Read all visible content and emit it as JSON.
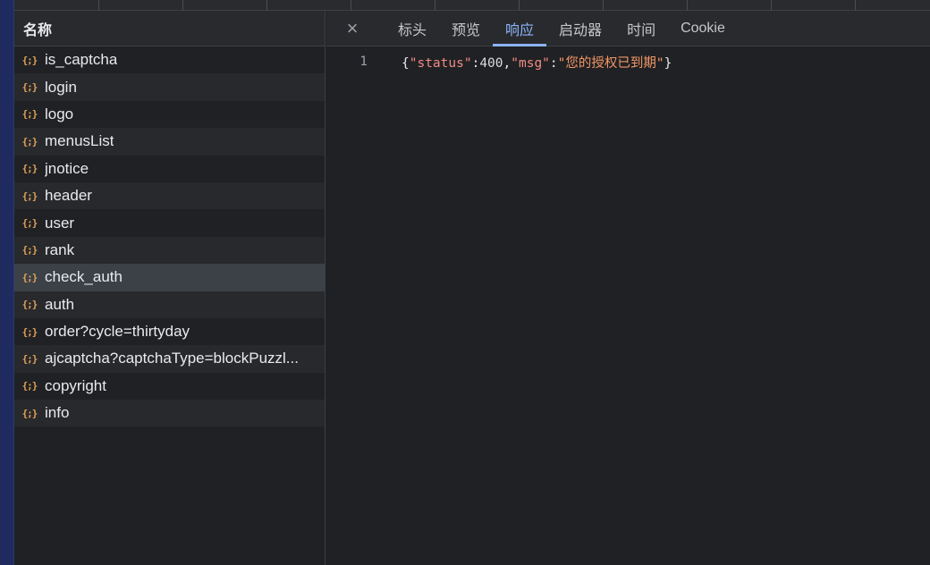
{
  "left_panel": {
    "header_label": "名称",
    "requests": [
      {
        "icon": "{;}",
        "name": "is_captcha"
      },
      {
        "icon": "{;}",
        "name": "login"
      },
      {
        "icon": "{;}",
        "name": "logo"
      },
      {
        "icon": "{;}",
        "name": "menusList"
      },
      {
        "icon": "{;}",
        "name": "jnotice"
      },
      {
        "icon": "{;}",
        "name": "header"
      },
      {
        "icon": "{;}",
        "name": "user"
      },
      {
        "icon": "{;}",
        "name": "rank"
      },
      {
        "icon": "{;}",
        "name": "check_auth"
      },
      {
        "icon": "{;}",
        "name": "auth"
      },
      {
        "icon": "{;}",
        "name": "order?cycle=thirtyday"
      },
      {
        "icon": "{;}",
        "name": "ajcaptcha?captchaType=blockPuzzl..."
      },
      {
        "icon": "{;}",
        "name": "copyright"
      },
      {
        "icon": "{;}",
        "name": "info"
      }
    ],
    "selected_index": 8
  },
  "tabbar": {
    "close_icon": "×",
    "tabs": [
      {
        "label": "标头"
      },
      {
        "label": "预览"
      },
      {
        "label": "响应"
      },
      {
        "label": "启动器"
      },
      {
        "label": "时间"
      },
      {
        "label": "Cookie"
      }
    ],
    "active_index": 2
  },
  "response": {
    "line_number": "1",
    "tokens": [
      {
        "t": "punc",
        "v": "{"
      },
      {
        "t": "key",
        "v": "\"status\""
      },
      {
        "t": "punc",
        "v": ":"
      },
      {
        "t": "num",
        "v": "400"
      },
      {
        "t": "punc",
        "v": ","
      },
      {
        "t": "key",
        "v": "\"msg\""
      },
      {
        "t": "punc",
        "v": ":"
      },
      {
        "t": "str",
        "v": "\"您的授权已到期\""
      },
      {
        "t": "punc",
        "v": "}"
      }
    ]
  },
  "colors": {
    "accent": "#8ab4f8",
    "icon": "#e0a35a",
    "background": "#202124"
  }
}
